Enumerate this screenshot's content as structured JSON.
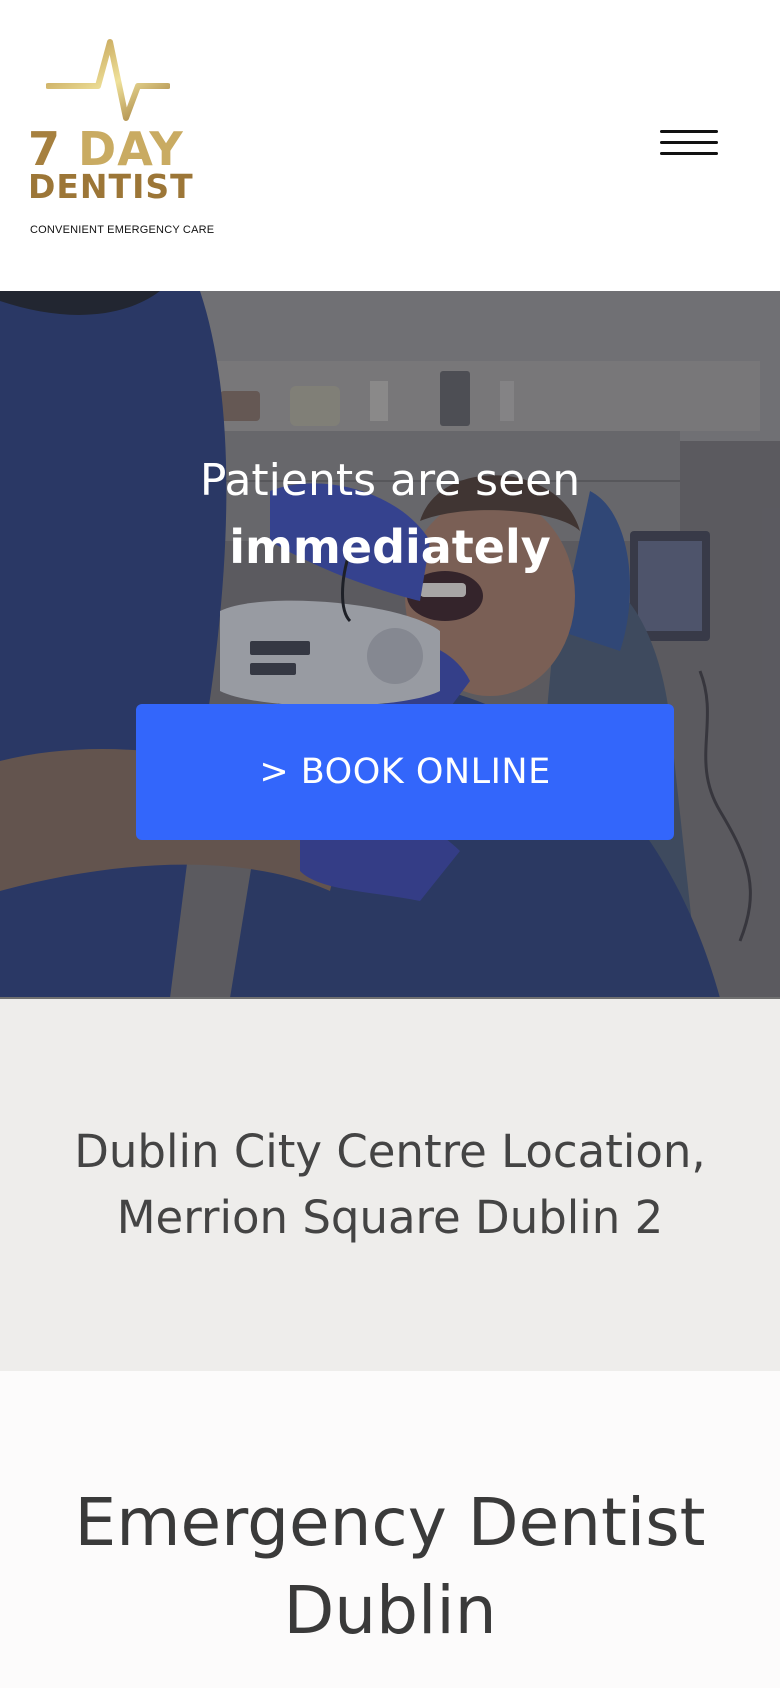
{
  "logo": {
    "line1_number": "7",
    "line1_word": "DAY",
    "line2": "DENTIST",
    "tagline": "CONVENIENT EMERGENCY CARE"
  },
  "header": {
    "menu_icon": "hamburger-menu-icon"
  },
  "hero": {
    "line1": "Patients are seen",
    "line2": "immediately",
    "button_label": "> BOOK ONLINE",
    "button_color": "#3366fb"
  },
  "location": {
    "line1": "Dublin City Centre Location,",
    "line2": "Merrion Square Dublin 2"
  },
  "section": {
    "title_line1": "Emergency Dentist",
    "title_line2": "Dublin"
  },
  "colors": {
    "gold": "#a6803f",
    "gold_light": "#e8d98a",
    "location_bg": "#eeedeb"
  }
}
